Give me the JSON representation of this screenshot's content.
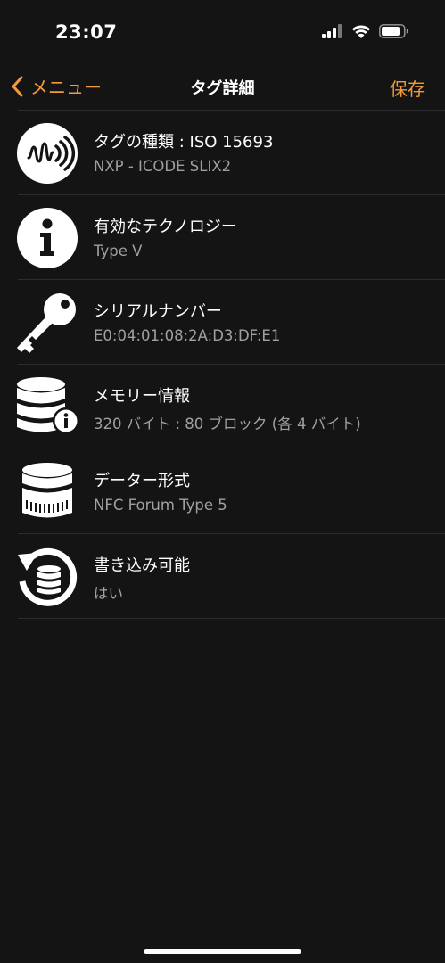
{
  "status_bar": {
    "time": "23:07",
    "icons": [
      "signal-icon",
      "wifi-icon",
      "battery-icon"
    ]
  },
  "nav": {
    "back_label": "メニュー",
    "title": "タグ詳細",
    "save_label": "保存"
  },
  "colors": {
    "accent": "#f39a3c",
    "background": "#141414",
    "secondary_text": "#a0a0a0",
    "divider": "#2c2c2c"
  },
  "items": [
    {
      "icon": "nfc-tag-icon",
      "title": "タグの種類 : ISO 15693",
      "value": "NXP - ICODE SLIX2"
    },
    {
      "icon": "info-icon",
      "title": "有効なテクノロジー",
      "value": "Type V"
    },
    {
      "icon": "key-icon",
      "title": "シリアルナンバー",
      "value": "E0:04:01:08:2A:D3:DF:E1"
    },
    {
      "icon": "memory-info-icon",
      "title": "メモリー情報",
      "value": "320 バイト : 80 ブロック (各 4 バイト)"
    },
    {
      "icon": "data-format-icon",
      "title": "データー形式",
      "value": "NFC Forum Type 5"
    },
    {
      "icon": "writable-icon",
      "title": "書き込み可能",
      "value": "はい"
    }
  ]
}
